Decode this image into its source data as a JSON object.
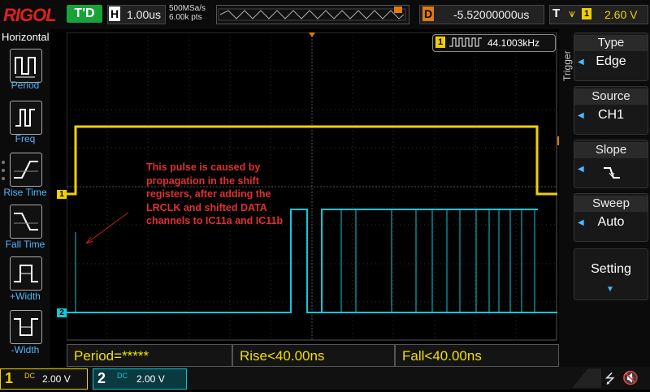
{
  "brand": "RIGOL",
  "status": "T'D",
  "horizontal": {
    "letter": "H",
    "timebase": "1.00us",
    "sample_rate": "500MSa/s",
    "points": "6.00k pts"
  },
  "delay": {
    "letter": "D",
    "value": "-5.52000000us"
  },
  "trigger_status": {
    "letter": "T",
    "channel": "1",
    "level": "2.60 V"
  },
  "left_panel": {
    "title": "Horizontal",
    "buttons": [
      {
        "label": "Period"
      },
      {
        "label": "Freq"
      },
      {
        "label": "Rise Time"
      },
      {
        "label": "Fall Time"
      },
      {
        "label": "+Width"
      },
      {
        "label": "-Width"
      }
    ]
  },
  "trigger_menu": {
    "title": "Trigger",
    "items": [
      {
        "title": "Type",
        "value": "Edge"
      },
      {
        "title": "Source",
        "value": "CH1"
      },
      {
        "title": "Slope",
        "value": "rising-edge-icon"
      },
      {
        "title": "Sweep",
        "value": "Auto"
      },
      {
        "title": "Setting",
        "value": ""
      }
    ]
  },
  "freq_counter": {
    "channel": "1",
    "value": "44.1003kHz"
  },
  "markers": {
    "ch1": "1",
    "ch2": "2",
    "trig": "T"
  },
  "annotation": "This pulse is caused by propagation in the shift registers, after adding the LRCLK and shifted DATA channels to IC11a and IC11b",
  "measurements": [
    "Period=*****",
    "Rise<40.00ns",
    "Fall<40.00ns"
  ],
  "channels": [
    {
      "num": "1",
      "coupling": "DC",
      "scale": "2.00 V",
      "color": "#f0d000"
    },
    {
      "num": "2",
      "coupling": "DC",
      "scale": "2.00 V",
      "color": "#10c8d8"
    }
  ],
  "icons": [
    "usb-icon",
    "mute-icon"
  ],
  "colors": {
    "ch1": "#f0d000",
    "ch2": "#10c8d8",
    "accent": "#4fb6ff",
    "brand": "#e02020",
    "trigger": "#e07b10"
  }
}
